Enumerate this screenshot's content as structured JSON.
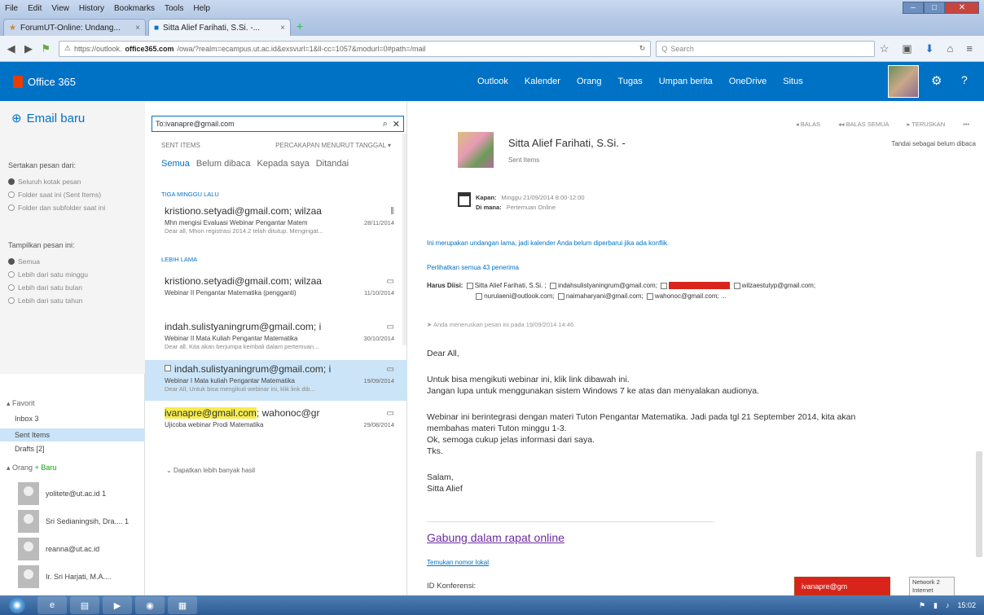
{
  "browser": {
    "menu": [
      "File",
      "Edit",
      "View",
      "History",
      "Bookmarks",
      "Tools",
      "Help"
    ],
    "tabs": [
      {
        "label": "ForumUT-Online: Undang..."
      },
      {
        "label": "Sitta Alief Farihati, S.Si. -..."
      }
    ],
    "url_prefix": "https://outlook.",
    "url_domain": "office365.com",
    "url_rest": "/owa/?realm=ecampus.ut.ac.id&exsvurl=1&ll-cc=1057&modurl=0#path=/mail",
    "search_placeholder": "Search"
  },
  "o365": {
    "brand": "Office 365",
    "nav": [
      "Outlook",
      "Kalender",
      "Orang",
      "Tugas",
      "Umpan berita",
      "OneDrive",
      "Situs"
    ]
  },
  "left": {
    "new_mail": "Email baru",
    "show_from_label": "Sertakan pesan dari:",
    "scope_options": [
      "Seluruh kotak pesan",
      "Folder saat ini (Sent Items)",
      "Folder dan subfolder saat ini"
    ],
    "show_msgs_label": "Tampilkan pesan ini:",
    "time_options": [
      "Semua",
      "Lebih dari satu minggu",
      "Lebih dari satu bulan",
      "Lebih dari satu tahun"
    ],
    "favorites_label": "Favorit",
    "folders": [
      "Inbox  3",
      "Sent Items",
      "Drafts  [2]"
    ],
    "people_label": "Orang",
    "people_new": "Baru",
    "people": [
      "yolitete@ut.ac.id  1",
      "Sri Sedianingsih, Dra....  1",
      "reanna@ut.ac.id",
      "Ir. Sri Harjati, M.A...."
    ]
  },
  "middle": {
    "search_value": "To:ivanapre@gmail.com",
    "sent_items_label": "SENT ITEMS",
    "sort_label": "PERCAKAPAN MENURUT TANGGAL",
    "filters": [
      "Semua",
      "Belum dibaca",
      "Kepada saya",
      "Ditandai"
    ],
    "group_3w": "TIGA MINGGU LALU",
    "group_older": "LEBIH LAMA",
    "messages": [
      {
        "from": "kristiono.setyadi@gmail.com; wilzaa",
        "subject": "Mhn mengisi Evaluasi Webinar Pengantar Matem",
        "date": "28/11/2014",
        "preview": "Dear all,   Mhon registrasi 2014.2 telah ditutup. Mengingat..."
      },
      {
        "from": "kristiono.setyadi@gmail.com; wilzaa",
        "subject": "Webinar II Pengantar Matematika (pengganti)",
        "date": "11/10/2014",
        "preview": ""
      },
      {
        "from": "indah.sulistyaningrum@gmail.com; i",
        "subject": "Webinar II Mata Kuliah Pengantar Matematika",
        "date": "30/10/2014",
        "preview": "Dear all,   Kita akan berjumpa kembali dalam pertemuan..."
      },
      {
        "from": "indah.sulistyaningrum@gmail.com; i",
        "subject": "Webinar I Mata kuliah Pengantar Matematika",
        "date": "19/09/2014",
        "preview": "Dear All,   Untuk bisa mengikuti webinar ini, klik link dib..."
      },
      {
        "from_hl": "ivanapre@gmail.com",
        "from_rest": "; wahonoc@gr",
        "subject": "Ujicoba webinar Prodi Matematika",
        "date": "29/08/2014"
      }
    ],
    "load_more": "Dapatkan lebih banyak hasil"
  },
  "reading": {
    "actions": [
      "BALAS",
      "BALAS SEMUA",
      "TERUSKAN",
      "•••"
    ],
    "mark_unread": "Tandai sebagai belum dibaca",
    "sender": "Sitta Alief Farihati, S.Si. -",
    "folder": "Sent Items",
    "when_label": "Kapan:",
    "when_value": "Minggu 21/09/2014 8:00-12:00",
    "where_label": "Di mana:",
    "where_value": "Pertemuan Online",
    "invite_note": "Ini merupakan undangan lama, jadi kalender Anda belum diperbarui jika ada konflik.",
    "show_all": "Perlihatkan semua 43 penerima",
    "to_label": "Harus Diisi:",
    "recipients_line1": [
      "Sitta Alief Farihati, S.Si. ;",
      "indahsulistyaningrum@gmail.com;"
    ],
    "recipient_hl": "ivanapre@gmail.com",
    "recipients_line1b": "wilzaestutyp@gmail.com;",
    "recipients_line2": [
      "nurulaeni@outlook.com;",
      "naimaharyani@gmail.com;",
      "wahonoc@gmail.com;",
      "..."
    ],
    "sent_note": "Anda meneruskan pesan ini pada 19/09/2014 14:46.",
    "greeting": "Dear All,",
    "para1": [
      "Untuk bisa mengikuti webinar ini, klik link dibawah ini.",
      "Jangan lupa untuk menggunakan sistem Windows 7 ke atas dan menyalakan audionya."
    ],
    "para2": [
      "Webinar ini berintegrasi dengan materi Tuton Pengantar Matematika. Jadi pada tgl 21 September 2014, kita akan",
      "membahas materi Tuton minggu 1-3.",
      "Ok, semoga cukup jelas informasi dari saya.",
      "Tks."
    ],
    "closing": [
      "Salam,",
      "Sitta Alief"
    ],
    "join_link": "Gabung dalam rapat online",
    "small_link": "Temukan nomor lokal",
    "conf_id": "ID Konferensi:"
  },
  "overlay": {
    "notif": "ivanapre@gm",
    "net": [
      "Network 2",
      "Internet access"
    ]
  },
  "taskbar": {
    "clock": "15:02"
  }
}
